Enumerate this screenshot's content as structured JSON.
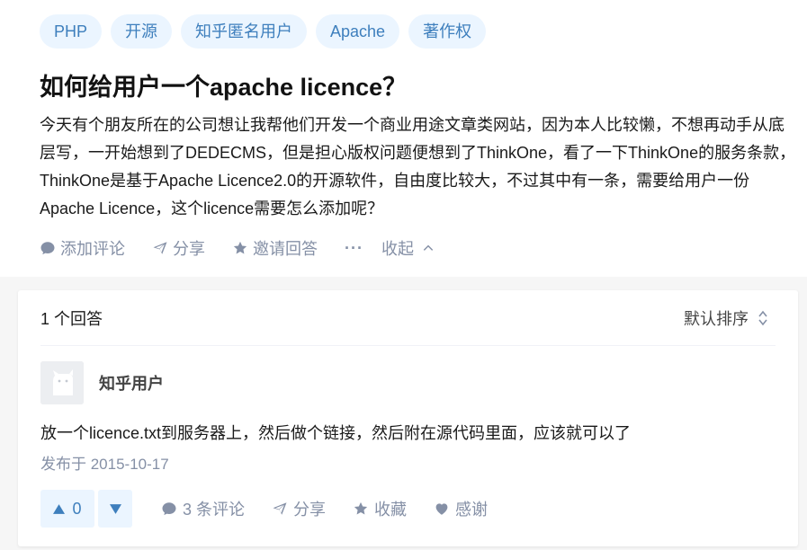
{
  "tags": [
    "PHP",
    "开源",
    "知乎匿名用户",
    "Apache",
    "著作权"
  ],
  "question": {
    "title": "如何给用户一个apache licence？",
    "body": "今天有个朋友所在的公司想让我帮他们开发一个商业用途文章类网站，因为本人比较懒，不想再动手从底层写，一开始想到了DEDECMS，但是担心版权问题便想到了ThinkOne，看了一下ThinkOne的服务条款，ThinkOne是基于Apache Licence2.0的开源软件，自由度比较大，不过其中有一条，需要给用户一份Apache Licence，这个licence需要怎么添加呢？",
    "actions": {
      "comment": "添加评论",
      "share": "分享",
      "invite": "邀请回答",
      "more": "···",
      "collapse": "收起"
    }
  },
  "answers": {
    "count_label": "1 个回答",
    "sort_label": "默认排序",
    "items": [
      {
        "author": "知乎用户",
        "text": "放一个licence.txt到服务器上，然后做个链接，然后附在源代码里面，应该就可以了",
        "date": "发布于 2015-10-17",
        "votes": "0",
        "comments": "3 条评论",
        "share": "分享",
        "favorite": "收藏",
        "thanks": "感谢"
      }
    ]
  },
  "colors": {
    "accent": "#3e7fbd",
    "tag_bg": "#ebf5ff",
    "muted": "#8590a6"
  }
}
